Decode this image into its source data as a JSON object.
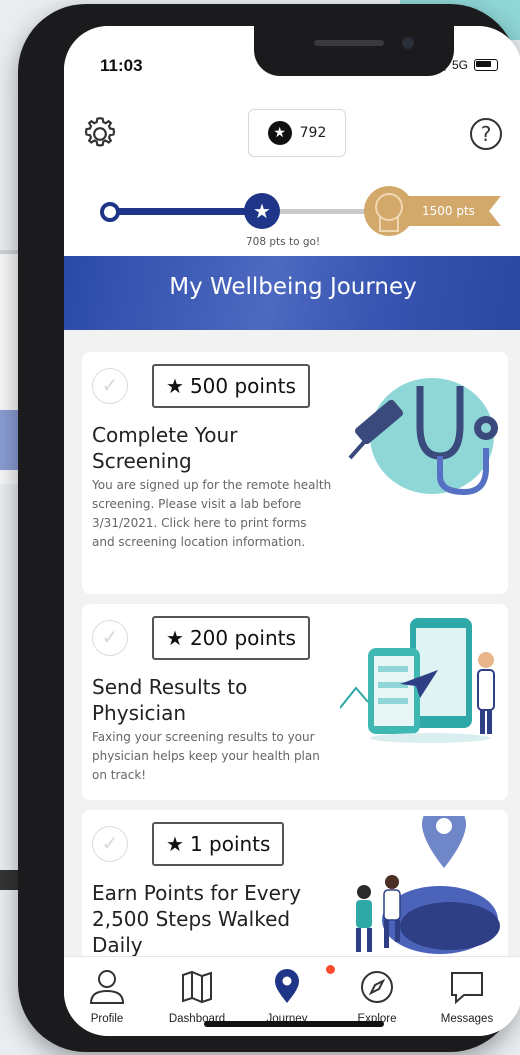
{
  "status_bar": {
    "time": "11:03",
    "network": "5G"
  },
  "header": {
    "points": "792"
  },
  "progress": {
    "remaining_label": "708 pts to go!",
    "goal_label": "1500 pts",
    "current_points": 792,
    "goal_points": 1500
  },
  "journey": {
    "title": "My Wellbeing Journey"
  },
  "cards": [
    {
      "points": "500 points",
      "title": "Complete Your Screening",
      "description": "You are signed up for the remote health screening. Please visit a lab before 3/31/2021. Click here to print forms and screening location information."
    },
    {
      "points": "200 points",
      "title": "Send Results to Physician",
      "description": "Faxing your screening results to your physician helps keep your health plan on track!"
    },
    {
      "points": "1 points",
      "title": "Earn Points for Every 2,500 Steps Walked Daily",
      "description": ""
    }
  ],
  "tabs": [
    {
      "label": "Profile",
      "icon": "person-icon"
    },
    {
      "label": "Dashboard",
      "icon": "map-icon"
    },
    {
      "label": "Journey",
      "icon": "location-pin-icon"
    },
    {
      "label": "Explore",
      "icon": "compass-icon"
    },
    {
      "label": "Messages",
      "icon": "chat-bubble-icon"
    }
  ],
  "colors": {
    "primary": "#1f3588",
    "gold": "#d2a96b",
    "teal": "#8fd6d6",
    "notification": "#ff4b2b"
  }
}
